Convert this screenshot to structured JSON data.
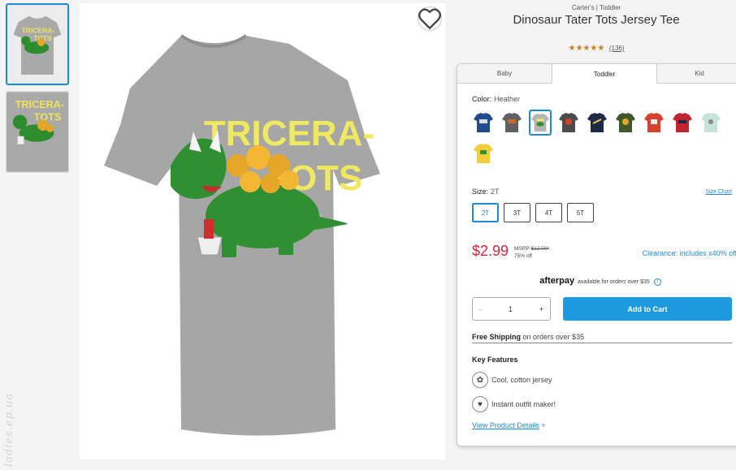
{
  "product": {
    "brand": "Carter's | Toddler",
    "title": "Dinosaur Tater Tots Jersey Tee",
    "stars": "★★★★★",
    "review_count": "(136)",
    "image_text_line1": "TRICERA-",
    "image_text_line2": "TOTS"
  },
  "tabs": [
    {
      "label": "Baby"
    },
    {
      "label": "Toddler"
    },
    {
      "label": "Kid"
    }
  ],
  "color": {
    "label": "Color:",
    "value": "Heather",
    "swatches": [
      {
        "name": "navy",
        "color": "#1f4a8e"
      },
      {
        "name": "charcoal",
        "color": "#5e6063"
      },
      {
        "name": "heather",
        "color": "#b5b5b5"
      },
      {
        "name": "dark gray",
        "color": "#4c4c4c"
      },
      {
        "name": "dark navy",
        "color": "#1c2a4a"
      },
      {
        "name": "olive",
        "color": "#3e5a2a"
      },
      {
        "name": "red-orange",
        "color": "#d8412c"
      },
      {
        "name": "red",
        "color": "#c1232f"
      },
      {
        "name": "mint",
        "color": "#c6e3d8"
      },
      {
        "name": "yellow",
        "color": "#f2cf3a"
      }
    ]
  },
  "size": {
    "label": "Size:",
    "value": "2T",
    "chart_link": "Size Chart",
    "options": [
      "2T",
      "3T",
      "4T",
      "5T"
    ]
  },
  "pricing": {
    "price": "$2.99",
    "msrp_label": "MSRP",
    "msrp_value": "$12.00*",
    "discount": "75% off",
    "clearance": "Clearance: includes x40% off"
  },
  "afterpay": {
    "logo": "afterpay",
    "text": "available for orders over $35",
    "info": "i"
  },
  "cart": {
    "minus": "-",
    "quantity": "1",
    "plus": "+",
    "add_label": "Add to Cart"
  },
  "shipping": {
    "bold": "Free Shipping",
    "rest": "on orders over $35"
  },
  "features": {
    "heading": "Key Features",
    "items": [
      {
        "label": "Cool, cotton jersey",
        "icon": "cotton-icon"
      },
      {
        "label": "Instant outfit maker!",
        "icon": "heart-badge-icon"
      }
    ],
    "details_link": "View Product Details",
    "details_plus": "+"
  },
  "watermark": "ladies.ep.ua",
  "colors": {
    "accent": "#1e8ad6",
    "price": "#d6263e",
    "star": "#d57b1d",
    "cart_button": "#1e9be0"
  }
}
